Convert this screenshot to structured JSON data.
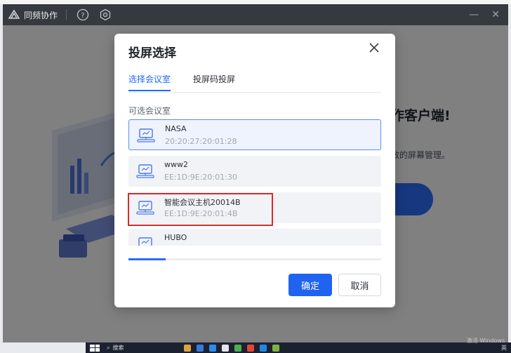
{
  "titlebar": {
    "app_name": "同频协作"
  },
  "hero": {
    "title": "作客户端!",
    "subtitle": "效的屏幕管理。"
  },
  "dialog": {
    "title": "投屏选择",
    "tabs": [
      {
        "label": "选择会议室"
      },
      {
        "label": "投屏码投屏"
      }
    ],
    "section_label": "可选会议室",
    "rooms": [
      {
        "name": "NASA",
        "mac": "20:20:27:20:01:28"
      },
      {
        "name": "www2",
        "mac": "EE:1D:9E:20:01:30"
      },
      {
        "name": "智能会议主机20014B",
        "mac": "EE:1D:9E:20:01:4B"
      },
      {
        "name": "HUBO",
        "mac": ""
      }
    ],
    "ok_label": "确定",
    "cancel_label": "取消"
  },
  "taskbar": {
    "search_placeholder": "搜索",
    "tray_lang": "英"
  },
  "watermark": "激活 Windows",
  "colors": {
    "accent": "#2063f1",
    "highlight": "#d9292d",
    "titlebar": "#36393f"
  },
  "icons": [
    "logo-icon",
    "help-icon",
    "settings-icon",
    "minimize-icon",
    "close-icon",
    "projector-icon"
  ]
}
